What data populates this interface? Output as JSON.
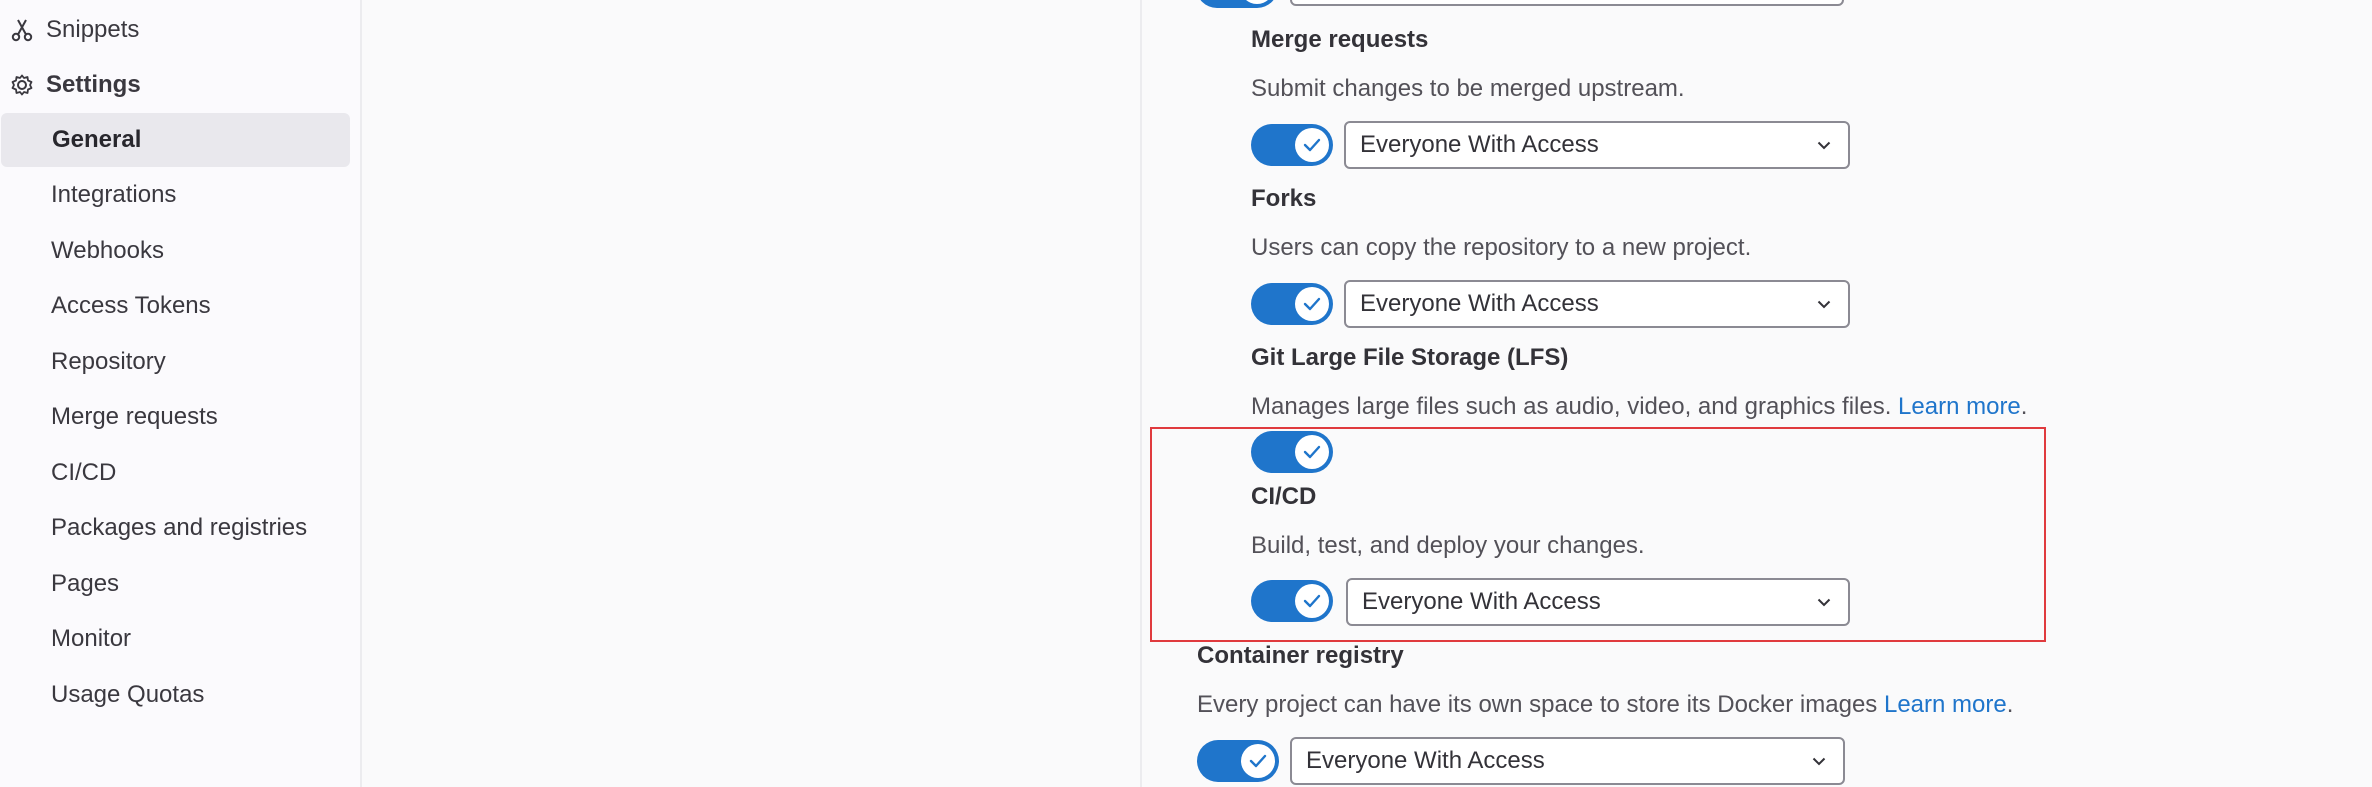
{
  "sidebar": {
    "snippets_label": "Snippets",
    "settings_label": "Settings",
    "items": [
      {
        "label": "General",
        "active": true
      },
      {
        "label": "Integrations"
      },
      {
        "label": "Webhooks"
      },
      {
        "label": "Access Tokens"
      },
      {
        "label": "Repository"
      },
      {
        "label": "Merge requests"
      },
      {
        "label": "CI/CD"
      },
      {
        "label": "Packages and registries"
      },
      {
        "label": "Pages"
      },
      {
        "label": "Monitor"
      },
      {
        "label": "Usage Quotas"
      }
    ]
  },
  "features": {
    "merge_requests": {
      "title": "Merge requests",
      "description": "Submit changes to be merged upstream.",
      "select_value": "Everyone With Access",
      "enabled": true
    },
    "forks": {
      "title": "Forks",
      "description": "Users can copy the repository to a new project.",
      "select_value": "Everyone With Access",
      "enabled": true
    },
    "lfs": {
      "title": "Git Large File Storage (LFS)",
      "description": "Manages large files such as audio, video, and graphics files.",
      "link": "Learn more",
      "enabled": true
    },
    "cicd": {
      "title": "CI/CD",
      "description": "Build, test, and deploy your changes.",
      "select_value": "Everyone With Access",
      "enabled": true
    },
    "container_registry": {
      "title": "Container registry",
      "description": "Every project can have its own space to store its Docker images",
      "link": "Learn more",
      "select_value": "Everyone With Access",
      "enabled": true
    }
  },
  "colors": {
    "accent": "#1f75cb",
    "highlight_border": "#e03a3e"
  }
}
